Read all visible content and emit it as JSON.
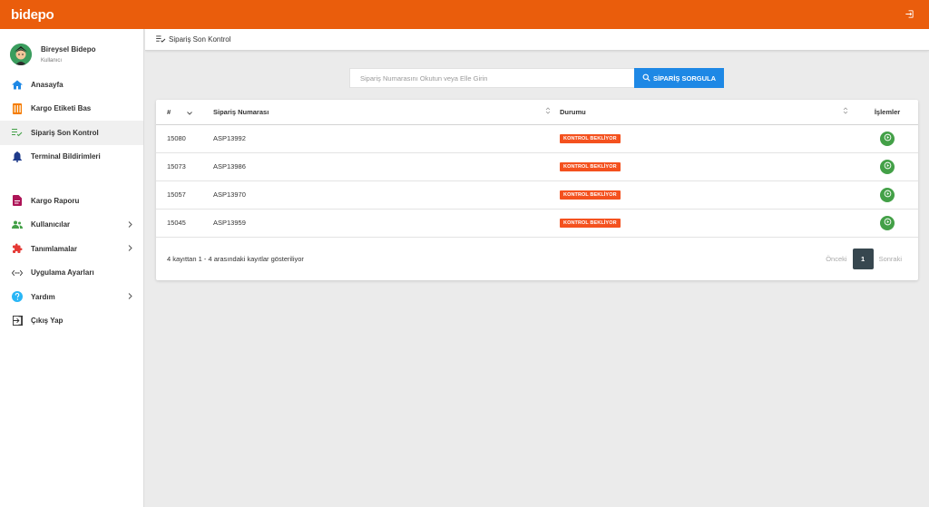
{
  "app": {
    "logo": "bidepo"
  },
  "user": {
    "name": "Bireysel Bidepo",
    "role": "Kullanıcı"
  },
  "sidebar": {
    "items": [
      {
        "label": "Anasayfa",
        "icon": "home-icon"
      },
      {
        "label": "Kargo Etiketi Bas",
        "icon": "barcode-icon"
      },
      {
        "label": "Sipariş Son Kontrol",
        "icon": "checklist-icon"
      },
      {
        "label": "Terminal Bildirimleri",
        "icon": "bell-icon"
      },
      {
        "label": "Kargo Raporu",
        "icon": "report-icon"
      },
      {
        "label": "Kullanıcılar",
        "icon": "users-icon"
      },
      {
        "label": "Tanımlamalar",
        "icon": "puzzle-icon"
      },
      {
        "label": "Uygulama Ayarları",
        "icon": "settings-ethernet-icon"
      },
      {
        "label": "Yardım",
        "icon": "help-icon"
      },
      {
        "label": "Çıkış Yap",
        "icon": "exit-icon"
      }
    ]
  },
  "header": {
    "title": "Sipariş Son Kontrol"
  },
  "search": {
    "placeholder": "Sipariş Numarasını Okutun veya Elle Girin",
    "value": "",
    "button_label": "SİPARİŞ SORGULA"
  },
  "table": {
    "columns": {
      "num": "#",
      "order": "Sipariş Numarası",
      "status": "Durumu",
      "actions": "İşlemler"
    },
    "rows": [
      {
        "id": "15080",
        "order": "ASP13992",
        "status": "KONTROL BEKLİYOR"
      },
      {
        "id": "15073",
        "order": "ASP13986",
        "status": "KONTROL BEKLİYOR"
      },
      {
        "id": "15057",
        "order": "ASP13970",
        "status": "KONTROL BEKLİYOR"
      },
      {
        "id": "15045",
        "order": "ASP13959",
        "status": "KONTROL BEKLİYOR"
      }
    ]
  },
  "footer": {
    "info": "4 kayıttan 1 - 4 arasındaki kayıtlar gösteriliyor",
    "prev": "Önceki",
    "page": "1",
    "next": "Sonraki"
  },
  "colors": {
    "brand": "#ea5d0c",
    "primary": "#1e88e5",
    "badge": "#f4511e",
    "action": "#43a047",
    "pager_active": "#37474f"
  }
}
